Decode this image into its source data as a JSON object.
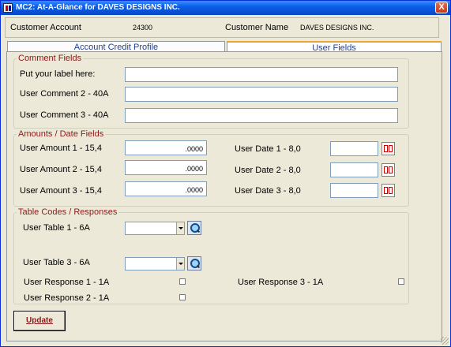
{
  "window": {
    "title": "MC2: At-A-Glance for DAVES DESIGNS INC.",
    "close_label": "X"
  },
  "header": {
    "account_label": "Customer Account",
    "account_value": "24300",
    "name_label": "Customer Name",
    "name_value": "DAVES DESIGNS INC."
  },
  "tabs": [
    {
      "label": "Account Credit Profile",
      "active": false
    },
    {
      "label": "User Fields",
      "active": true
    }
  ],
  "comment_group": {
    "title": "Comment Fields",
    "fields": [
      {
        "label": "Put your label here:",
        "value": ""
      },
      {
        "label": "User Comment 2 - 40A",
        "value": ""
      },
      {
        "label": "User Comment 3 - 40A",
        "value": ""
      }
    ]
  },
  "amount_group": {
    "title": "Amounts / Date Fields",
    "amounts": [
      {
        "label": "User Amount 1 - 15,4",
        "value": ".0000"
      },
      {
        "label": "User Amount 2 - 15,4",
        "value": ".0000"
      },
      {
        "label": "User Amount 3 - 15,4",
        "value": ".0000"
      }
    ],
    "dates": [
      {
        "label": "User Date 1 - 8,0",
        "value": ""
      },
      {
        "label": "User Date 2 - 8,0",
        "value": ""
      },
      {
        "label": "User Date 3 - 8,0",
        "value": ""
      }
    ]
  },
  "table_group": {
    "title": "Table Codes / Responses",
    "tables": [
      {
        "label": "User Table 1 - 6A",
        "value": ""
      },
      {
        "label": "User Table 3 - 6A",
        "value": ""
      }
    ],
    "responses": [
      {
        "label": "User Response 1 - 1A",
        "checked": false
      },
      {
        "label": "User Response 2 - 1A",
        "checked": false
      },
      {
        "label": "User Response 3 - 1A",
        "checked": false
      }
    ]
  },
  "actions": {
    "update_label": "Update"
  },
  "colors": {
    "title_bar": "#0a5fe8",
    "group_title": "#8b1a1a",
    "tab_text": "#1f3f8f",
    "window_bg": "#ece9d8"
  }
}
